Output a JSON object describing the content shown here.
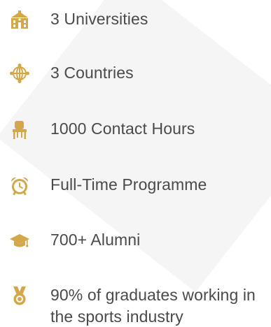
{
  "accent_color": "#d3a84b",
  "features": [
    {
      "icon": "university-building-icon",
      "label": "3 Universities"
    },
    {
      "icon": "globe-network-icon",
      "label": "3 Countries"
    },
    {
      "icon": "school-desk-icon",
      "label": "1000 Contact Hours"
    },
    {
      "icon": "alarm-clock-icon",
      "label": "Full-Time Programme"
    },
    {
      "icon": "graduation-cap-icon",
      "label": "700+ Alumni"
    },
    {
      "icon": "medal-icon",
      "label": "90% of graduates working in the sports industry"
    }
  ]
}
